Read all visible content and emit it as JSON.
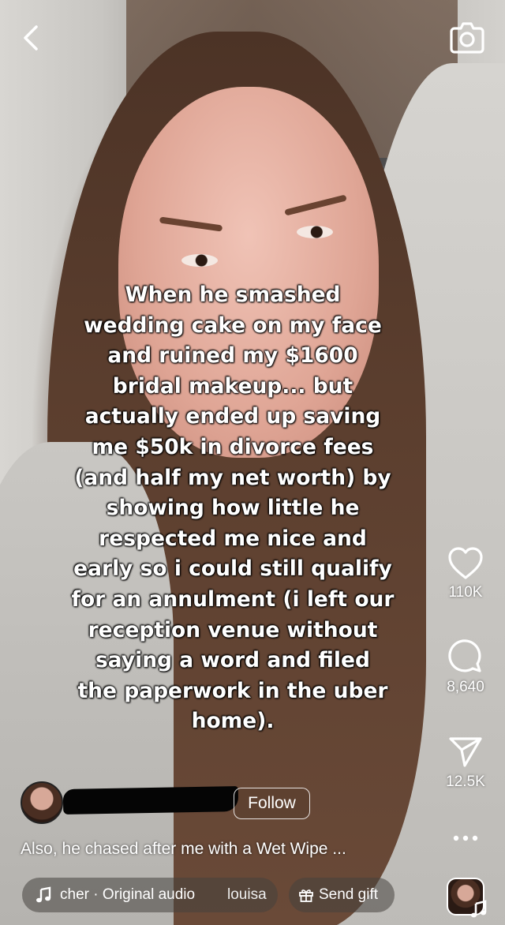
{
  "caption_lines": [
    "When he smashed",
    "wedding cake on my face",
    "and ruined my $1600",
    "bridal makeup... but",
    "actually ended up saving",
    "me $50k in divorce fees",
    "(and half my net worth) by",
    "showing how little he",
    "respected me nice and",
    "early so i could still qualify",
    "for an annulment (i left our",
    "reception venue without",
    "saying a word and filed",
    "the paperwork in the uber",
    "home)."
  ],
  "actions": {
    "likes": "110K",
    "comments": "8,640",
    "shares": "12.5K"
  },
  "user": {
    "follow_label": "Follow"
  },
  "description": "Also, he chased after me with a Wet Wipe ...",
  "audio": {
    "text": "cher · Original audio",
    "next_text": "louisa"
  },
  "gift": {
    "label": "Send gift"
  },
  "icons": {
    "back": "chevron-left-icon",
    "camera": "camera-icon",
    "like": "heart-icon",
    "comment": "comment-icon",
    "share": "paper-plane-icon",
    "more": "more-horizontal-icon",
    "audio": "music-note-icon",
    "gift": "gift-icon"
  }
}
